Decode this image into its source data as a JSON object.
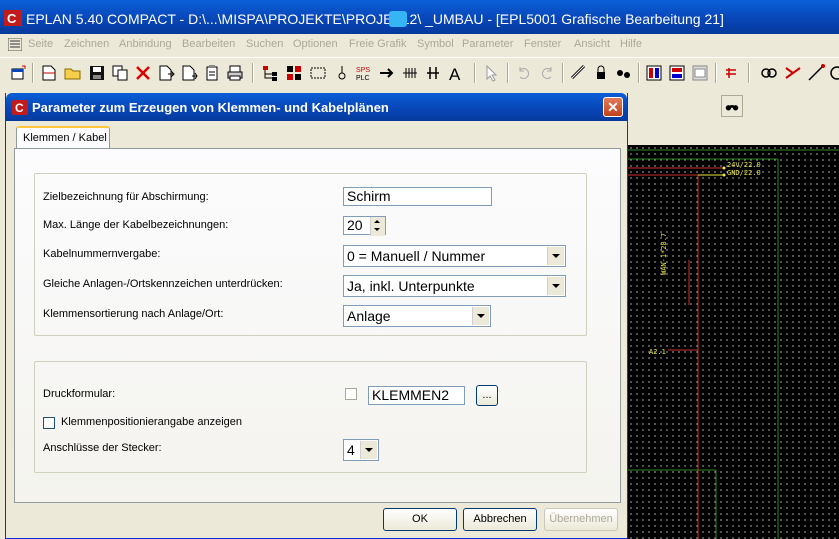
{
  "window": {
    "title": "EPLAN 5.40 COMPACT - D:\\...\\MISPA\\PROJEKTE\\PROJEK12\\  _UMBAU - [EPL5001 Grafische Bearbeitung 21]"
  },
  "menu": [
    "Seite",
    "Zeichnen",
    "Anbindung",
    "Bearbeiten",
    "Suchen",
    "Optionen",
    "Freie Grafik",
    "Symbol",
    "Parameter",
    "Fenster",
    "Ansicht",
    "Hilfe"
  ],
  "toolbar": {
    "icons": [
      "new-window-icon",
      "new-page-icon",
      "open-folder-icon",
      "save-icon",
      "copy-icon",
      "delete-icon",
      "page-in-icon",
      "page-out-icon",
      "clipboard-icon",
      "print-icon",
      "tree-icon",
      "structure-icon",
      "frame-icon",
      "symbol-icon",
      "sps-icon",
      "arrow-right-icon",
      "terminal-strip-icon",
      "connector-icon",
      "text-icon",
      "pointer-icon",
      "undo-icon",
      "redo-icon",
      "ruler-icon",
      "lock-icon",
      "group-icon",
      "plc-icon",
      "macro-icon",
      "window-icon",
      "red-icon",
      "link-icon",
      "crosshair-icon",
      "line-icon",
      "circle-icon"
    ],
    "sps_text": "SPS\nPLC",
    "text_icon_letter": "A"
  },
  "dialog": {
    "title": "Parameter zum Erzeugen von Klemmen- und Kabelplänen",
    "tab_label": "Klemmen / Kabel",
    "group1": {
      "shield_label": "Zielbezeichnung für Abschirmung:",
      "shield_value": "Schirm",
      "maxlen_label": "Max. Länge der Kabelbezeichnungen:",
      "maxlen_value": "20",
      "numbering_label": "Kabelnummernvergabe:",
      "numbering_value": "0 = Manuell / Nummer",
      "suppress_label": "Gleiche Anlagen-/Ortskennzeichen unterdrücken:",
      "suppress_value": "Ja, inkl. Unterpunkte",
      "sorting_label": "Klemmensortierung nach Anlage/Ort:",
      "sorting_value": "Anlage"
    },
    "group2": {
      "form_label": "Druckformular:",
      "form_value": "KLEMMEN2",
      "browse_label": "...",
      "position_label": "Klemmenpositionierangabe anzeigen",
      "connectors_label": "Anschlüsse der Stecker:",
      "connectors_value": "4"
    },
    "buttons": {
      "ok": "OK",
      "cancel": "Abbrechen",
      "apply": "Übernehmen"
    }
  },
  "drawing": {
    "labels": [
      "24V/22.0",
      "GND/22.0",
      "WAN-1*28.7",
      "A2.1"
    ],
    "colors": {
      "background": "#000000",
      "grid": "#bdbdbd",
      "frame": "#2a8a2a",
      "wire": "#d03030",
      "label": "#e8e84a"
    }
  }
}
